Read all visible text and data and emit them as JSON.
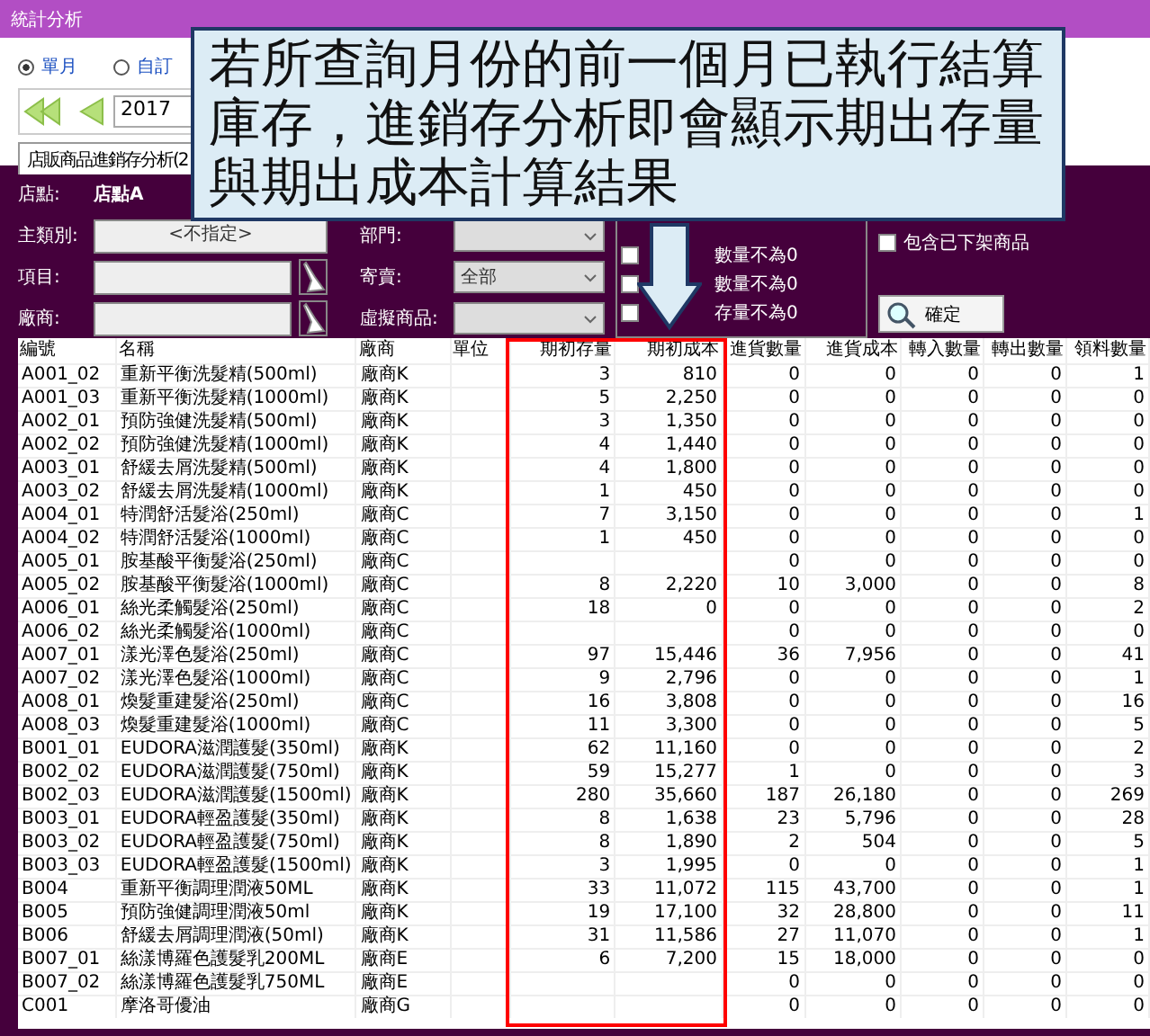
{
  "window": {
    "title": "統計分析"
  },
  "period": [
    {
      "label": "單月",
      "selected": true
    },
    {
      "label": "自訂",
      "selected": false
    }
  ],
  "year": {
    "value": "2017"
  },
  "tab": {
    "label": "店販商品進銷存分析(2",
    "selected": true
  },
  "filters": {
    "store_label": "店點:",
    "store_value": "店點A",
    "category_label": "主類別:",
    "category_value": "<不指定>",
    "dept_label": "部門:",
    "item_label": "項目:",
    "consign_label": "寄賣:",
    "consign_value": "全部",
    "vendor_label": "廠商:",
    "virtual_label": "虛擬商品:"
  },
  "checks": [
    {
      "label": "數量不為0",
      "checked": false
    },
    {
      "label": "數量不為0",
      "checked": false
    },
    {
      "label": "存量不為0",
      "checked": false
    }
  ],
  "include_removed": {
    "label": "包含已下架商品",
    "checked": false
  },
  "confirm": "確定",
  "callout": "若所查詢月份的前一個月已執行結算庫存，進銷存分析即會顯示期出存量與期出成本計算結果",
  "table": {
    "columns": [
      "編號",
      "名稱",
      "廠商",
      "單位",
      "期初存量",
      "期初成本",
      "進貨數量",
      "進貨成本",
      "轉入數量",
      "轉出數量",
      "領料數量"
    ],
    "rows": [
      [
        "A001_02",
        "重新平衡洗髮精(500ml)",
        "廠商K",
        null,
        "3",
        "810",
        "0",
        "0",
        "0",
        "0",
        "1"
      ],
      [
        "A001_03",
        "重新平衡洗髮精(1000ml)",
        "廠商K",
        null,
        "5",
        "2,250",
        "0",
        "0",
        "0",
        "0",
        "0"
      ],
      [
        "A002_01",
        "預防強健洗髮精(500ml)",
        "廠商K",
        null,
        "3",
        "1,350",
        "0",
        "0",
        "0",
        "0",
        "0"
      ],
      [
        "A002_02",
        "預防強健洗髮精(1000ml)",
        "廠商K",
        null,
        "4",
        "1,440",
        "0",
        "0",
        "0",
        "0",
        "0"
      ],
      [
        "A003_01",
        "舒緩去屑洗髮精(500ml)",
        "廠商K",
        null,
        "4",
        "1,800",
        "0",
        "0",
        "0",
        "0",
        "0"
      ],
      [
        "A003_02",
        "舒緩去屑洗髮精(1000ml)",
        "廠商K",
        null,
        "1",
        "450",
        "0",
        "0",
        "0",
        "0",
        "0"
      ],
      [
        "A004_01",
        "特潤舒活髮浴(250ml)",
        "廠商C",
        null,
        "7",
        "3,150",
        "0",
        "0",
        "0",
        "0",
        "1"
      ],
      [
        "A004_02",
        "特潤舒活髮浴(1000ml)",
        "廠商C",
        null,
        "1",
        "450",
        "0",
        "0",
        "0",
        "0",
        "0"
      ],
      [
        "A005_01",
        "胺基酸平衡髮浴(250ml)",
        "廠商C",
        null,
        null,
        null,
        "0",
        "0",
        "0",
        "0",
        "0"
      ],
      [
        "A005_02",
        "胺基酸平衡髮浴(1000ml)",
        "廠商C",
        null,
        "8",
        "2,220",
        "10",
        "3,000",
        "0",
        "0",
        "8"
      ],
      [
        "A006_01",
        "絲光柔觸髮浴(250ml)",
        "廠商C",
        null,
        "18",
        "0",
        "0",
        "0",
        "0",
        "0",
        "2"
      ],
      [
        "A006_02",
        "絲光柔觸髮浴(1000ml)",
        "廠商C",
        null,
        null,
        null,
        "0",
        "0",
        "0",
        "0",
        "0"
      ],
      [
        "A007_01",
        "漾光澤色髮浴(250ml)",
        "廠商C",
        null,
        "97",
        "15,446",
        "36",
        "7,956",
        "0",
        "0",
        "41"
      ],
      [
        "A007_02",
        "漾光澤色髮浴(1000ml)",
        "廠商C",
        null,
        "9",
        "2,796",
        "0",
        "0",
        "0",
        "0",
        "1"
      ],
      [
        "A008_01",
        "煥髮重建髮浴(250ml)",
        "廠商C",
        null,
        "16",
        "3,808",
        "0",
        "0",
        "0",
        "0",
        "16"
      ],
      [
        "A008_03",
        "煥髮重建髮浴(1000ml)",
        "廠商C",
        null,
        "11",
        "3,300",
        "0",
        "0",
        "0",
        "0",
        "5"
      ],
      [
        "B001_01",
        "EUDORA滋潤護髮(350ml)",
        "廠商K",
        null,
        "62",
        "11,160",
        "0",
        "0",
        "0",
        "0",
        "2"
      ],
      [
        "B002_02",
        "EUDORA滋潤護髮(750ml)",
        "廠商K",
        null,
        "59",
        "15,277",
        "1",
        "0",
        "0",
        "0",
        "3"
      ],
      [
        "B002_03",
        "EUDORA滋潤護髮(1500ml)",
        "廠商K",
        null,
        "280",
        "35,660",
        "187",
        "26,180",
        "0",
        "0",
        "269"
      ],
      [
        "B003_01",
        "EUDORA輕盈護髮(350ml)",
        "廠商K",
        null,
        "8",
        "1,638",
        "23",
        "5,796",
        "0",
        "0",
        "28"
      ],
      [
        "B003_02",
        "EUDORA輕盈護髮(750ml)",
        "廠商K",
        null,
        "8",
        "1,890",
        "2",
        "504",
        "0",
        "0",
        "5"
      ],
      [
        "B003_03",
        "EUDORA輕盈護髮(1500ml)",
        "廠商K",
        null,
        "3",
        "1,995",
        "0",
        "0",
        "0",
        "0",
        "1"
      ],
      [
        "B004",
        "重新平衡調理潤液50ML",
        "廠商K",
        null,
        "33",
        "11,072",
        "115",
        "43,700",
        "0",
        "0",
        "1"
      ],
      [
        "B005",
        "預防強健調理潤液50ml",
        "廠商K",
        null,
        "19",
        "17,100",
        "32",
        "28,800",
        "0",
        "0",
        "11"
      ],
      [
        "B006",
        "舒緩去屑調理潤液(50ml)",
        "廠商K",
        null,
        "31",
        "11,586",
        "27",
        "11,070",
        "0",
        "0",
        "1"
      ],
      [
        "B007_01",
        "絲漾博羅色護髮乳200ML",
        "廠商E",
        null,
        "6",
        "7,200",
        "15",
        "18,000",
        "0",
        "0",
        "0"
      ],
      [
        "B007_02",
        "絲漾博羅色護髮乳750ML",
        "廠商E",
        null,
        null,
        null,
        "0",
        "0",
        "0",
        "0",
        "0"
      ],
      [
        "C001",
        "摩洛哥優油",
        "廠商G",
        null,
        null,
        null,
        "0",
        "0",
        "0",
        "0",
        "0"
      ]
    ]
  }
}
